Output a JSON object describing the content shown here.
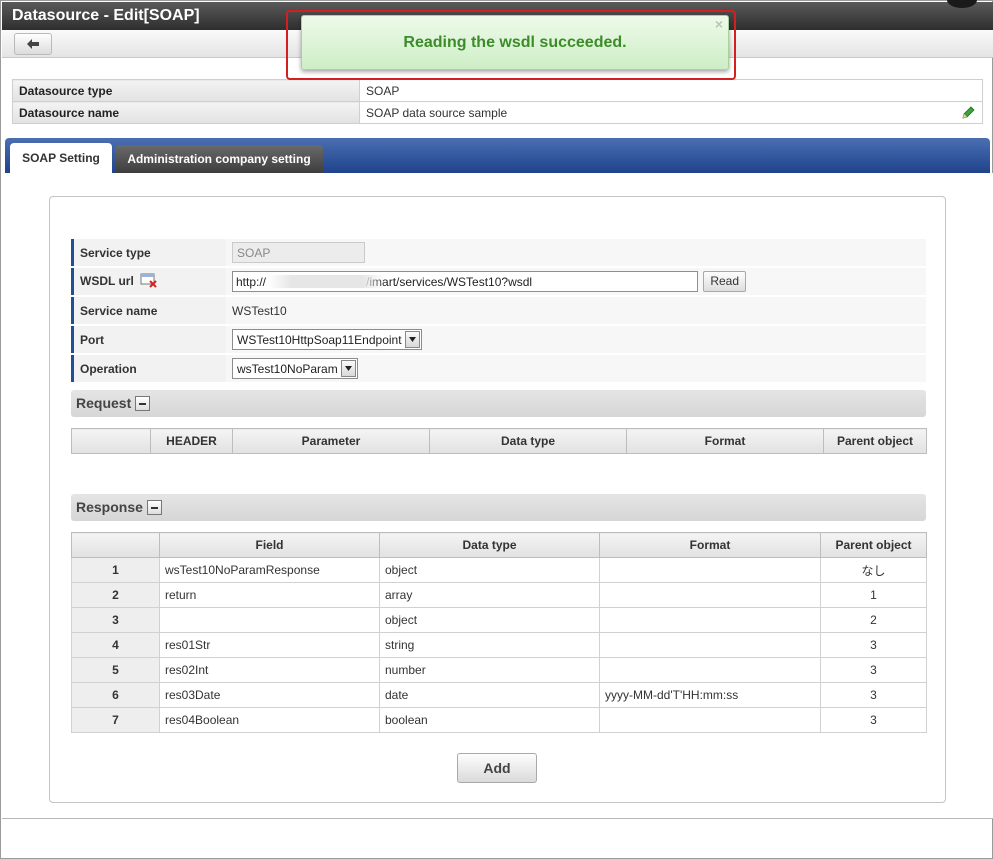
{
  "window": {
    "title": "Datasource - Edit[SOAP]"
  },
  "toast": {
    "message": "Reading the wsdl succeeded.",
    "close_glyph": "×"
  },
  "info": {
    "type_label": "Datasource type",
    "type_value": "SOAP",
    "name_label": "Datasource name",
    "name_value": "SOAP data source sample"
  },
  "tabs": [
    {
      "label": "SOAP Setting",
      "active": true
    },
    {
      "label": "Administration company setting",
      "active": false
    }
  ],
  "form": {
    "service_type_label": "Service type",
    "service_type_value": "SOAP",
    "wsdl_label": "WSDL url",
    "wsdl_value": "http://                              /imart/services/WSTest10?wsdl",
    "read_label": "Read",
    "service_name_label": "Service name",
    "service_name_value": "WSTest10",
    "port_label": "Port",
    "port_value": "WSTest10HttpSoap11Endpoint",
    "operation_label": "Operation",
    "operation_value": "wsTest10NoParam"
  },
  "request": {
    "title": "Request",
    "columns": [
      "",
      "HEADER",
      "Parameter",
      "Data type",
      "Format",
      "Parent object"
    ]
  },
  "response": {
    "title": "Response",
    "columns": [
      "",
      "Field",
      "Data type",
      "Format",
      "Parent object"
    ],
    "rows": [
      {
        "no": "1",
        "field": "wsTest10NoParamResponse",
        "type": "object",
        "format": "",
        "parent": "なし"
      },
      {
        "no": "2",
        "field": "return",
        "type": "array",
        "format": "",
        "parent": "1"
      },
      {
        "no": "3",
        "field": "",
        "type": "object",
        "format": "",
        "parent": "2"
      },
      {
        "no": "4",
        "field": "res01Str",
        "type": "string",
        "format": "",
        "parent": "3"
      },
      {
        "no": "5",
        "field": "res02Int",
        "type": "number",
        "format": "",
        "parent": "3"
      },
      {
        "no": "6",
        "field": "res03Date",
        "type": "date",
        "format": "yyyy-MM-dd'T'HH:mm:ss",
        "parent": "3"
      },
      {
        "no": "7",
        "field": "res04Boolean",
        "type": "boolean",
        "format": "",
        "parent": "3"
      }
    ]
  },
  "add_label": "Add",
  "icons": {
    "back": "back-arrow-icon",
    "edit": "pencil-icon",
    "clear": "trash-delete-icon",
    "collapse": "minus-icon",
    "dropdown": "chevron-down-icon"
  },
  "colors": {
    "tab_band": "#20438c",
    "toast_text": "#3d8c2a",
    "highlight_border": "#d21f1f"
  }
}
